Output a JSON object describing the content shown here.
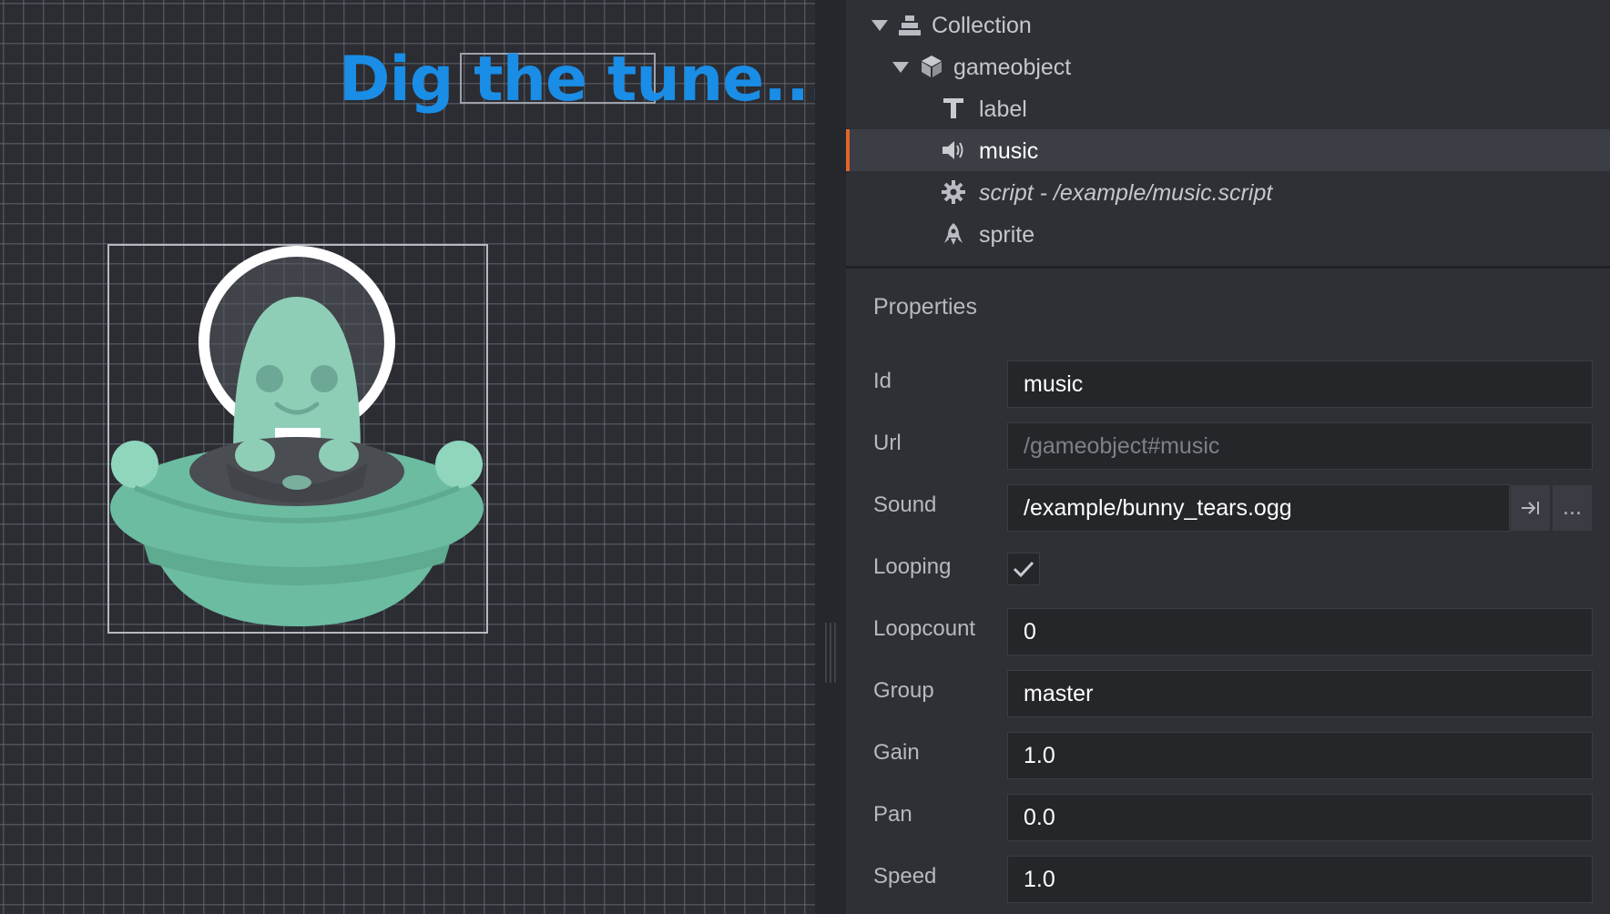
{
  "scene": {
    "label_text": "Dig the tune..."
  },
  "outline": {
    "items": [
      {
        "label": "Collection",
        "icon": "collection-icon",
        "expanded": true
      },
      {
        "label": "gameobject",
        "icon": "gameobject-icon",
        "expanded": true
      },
      {
        "label": "label",
        "icon": "text-label-icon"
      },
      {
        "label": "music",
        "icon": "sound-icon",
        "selected": true
      },
      {
        "label": "script - /example/music.script",
        "icon": "gear-icon"
      },
      {
        "label": "sprite",
        "icon": "sprite-icon"
      }
    ]
  },
  "properties": {
    "title": "Properties",
    "id": {
      "label": "Id",
      "value": "music"
    },
    "url": {
      "label": "Url",
      "value": "/gameobject#music"
    },
    "sound": {
      "label": "Sound",
      "value": "/example/bunny_tears.ogg",
      "browse_label": "..."
    },
    "looping": {
      "label": "Looping",
      "checked": true
    },
    "loopcount": {
      "label": "Loopcount",
      "value": "0"
    },
    "group": {
      "label": "Group",
      "value": "master"
    },
    "gain": {
      "label": "Gain",
      "value": "1.0"
    },
    "pan": {
      "label": "Pan",
      "value": "0.0"
    },
    "speed": {
      "label": "Speed",
      "value": "1.0"
    }
  },
  "colors": {
    "accent": "#e2652a",
    "label_text": "#1a8de6",
    "panel_bg": "#2e3035",
    "field_bg": "#24262a"
  }
}
